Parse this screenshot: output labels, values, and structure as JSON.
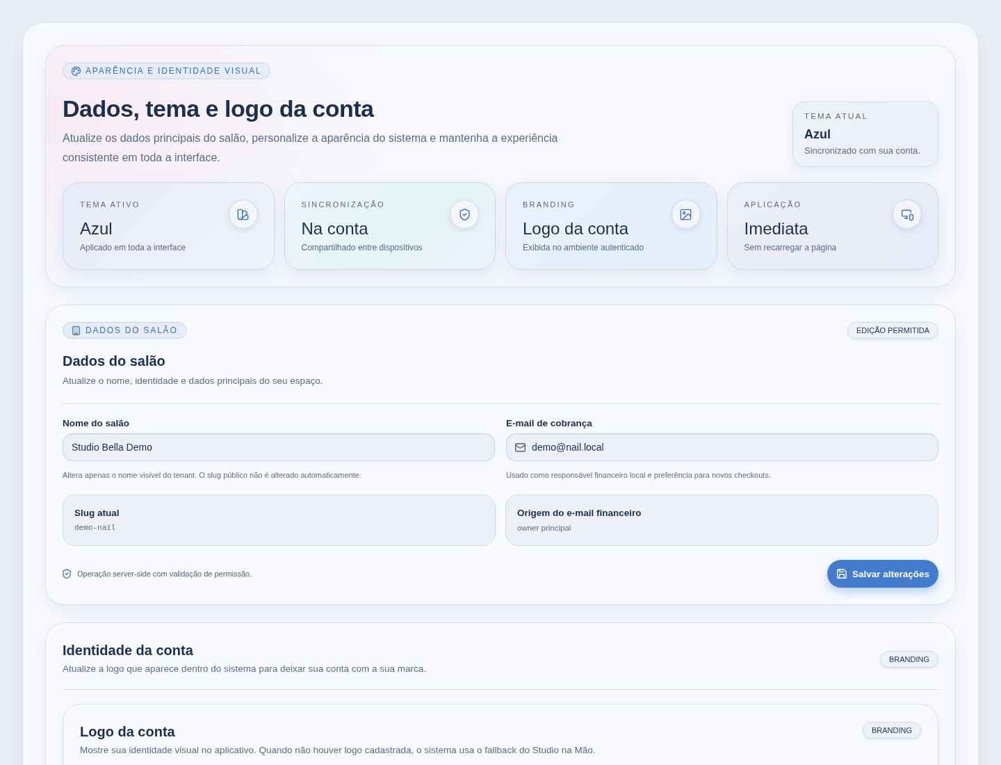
{
  "hero": {
    "eyebrow": "APARÊNCIA E IDENTIDADE VISUAL",
    "title": "Dados, tema e logo da conta",
    "description": "Atualize os dados principais do salão, personalize a aparência do sistema e mantenha a experiência consistente em toda a interface.",
    "current_theme": {
      "label": "TEMA ATUAL",
      "value": "Azul",
      "note": "Sincronizado com sua conta."
    },
    "stats": [
      {
        "kind": "theme",
        "label": "TEMA ATIVO",
        "value": "Azul",
        "note": "Aplicado em toda a interface"
      },
      {
        "kind": "sync",
        "label": "SINCRONIZAÇÃO",
        "value": "Na conta",
        "note": "Compartilhado entre dispositivos"
      },
      {
        "kind": "branding",
        "label": "BRANDING",
        "value": "Logo da conta",
        "note": "Exibida no ambiente autenticado"
      },
      {
        "kind": "application",
        "label": "APLICAÇÃO",
        "value": "Imediata",
        "note": "Sem recarregar a página"
      }
    ]
  },
  "salon": {
    "eyebrow": "DADOS DO SALÃO",
    "badge": "EDIÇÃO PERMITIDA",
    "title": "Dados do salão",
    "description": "Atualize o nome, identidade e dados principais do seu espaço.",
    "fields": [
      {
        "kind": "text",
        "label": "Nome do salão",
        "value": "Studio Bella Demo",
        "help": "Altera apenas o nome visível do tenant. O slug público não é alterado automaticamente."
      },
      {
        "kind": "email",
        "label": "E-mail de cobrança",
        "value": "demo@nail.local",
        "help": "Usado como responsável financeiro local e preferência para novos checkouts."
      }
    ],
    "info": [
      {
        "kind": "code",
        "label": "Slug atual",
        "value": "demo-nail"
      },
      {
        "kind": "text",
        "label": "Origem do e-mail financeiro",
        "value": "owner principal"
      }
    ],
    "security_note": "Operação server-side com validação de permissão.",
    "save_button": "Salvar alterações"
  },
  "identity": {
    "title": "Identidade da conta",
    "description": "Atualize a logo que aparece dentro do sistema para deixar sua conta com a sua marca.",
    "badge": "BRANDING",
    "logo_card": {
      "title": "Logo da conta",
      "description": "Mostre sua identidade visual no aplicativo. Quando não houver logo cadastrada, o sistema usa o fallback do Studio na Mão.",
      "badge": "BRANDING"
    }
  }
}
